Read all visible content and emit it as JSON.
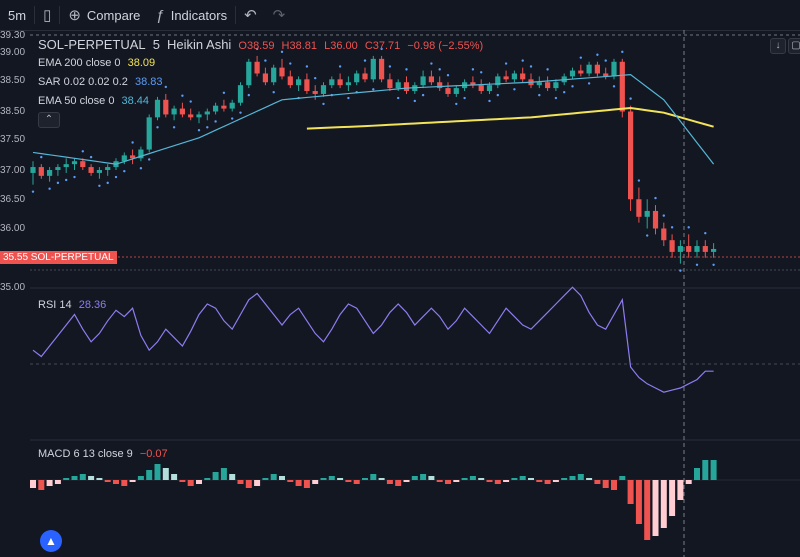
{
  "toolbar": {
    "interval": "5m",
    "compare_label": "Compare",
    "indicators_label": "Indicators"
  },
  "legend": {
    "symbol": "SOL-PERPETUAL",
    "timeframe": "5",
    "chart_style": "Heikin Ashi",
    "o": "O38.59",
    "h": "H38.81",
    "l": "L36.00",
    "c": "C37.71",
    "change": "−0.98 (−2.55%)",
    "ema200_label": "EMA 200 close 0",
    "ema200_value": "38.09",
    "sar_label": "SAR 0.02 0.02 0.2",
    "sar_value": "38.83",
    "ema50_label": "EMA 50 close 0",
    "ema50_value": "38.44"
  },
  "price_tag": "35.55 SOL-PERPETUAL",
  "rsi": {
    "label": "RSI 14",
    "value": "28.36"
  },
  "macd": {
    "label": "MACD 6 13 close 9",
    "value": "−0.07"
  },
  "colors": {
    "up": "#26a69a",
    "down": "#ef5350",
    "ema200": "#f2e35a",
    "ema50": "#55b6d6",
    "sar": "#5b9cf6",
    "rsi": "#8e7cf0",
    "background": "#131722"
  },
  "chart_data": [
    {
      "type": "candlestick",
      "title": "SOL-PERPETUAL 5 Heikin Ashi",
      "y_ticks": [
        "39.30",
        "39.00",
        "38.50",
        "38.00",
        "37.50",
        "37.00",
        "36.50",
        "36.00",
        "35.55",
        "35.00"
      ],
      "ylim": [
        35.0,
        39.3
      ],
      "candles": [
        [
          36.95,
          37.15,
          36.75,
          37.05
        ],
        [
          37.05,
          37.1,
          36.85,
          36.9
        ],
        [
          36.9,
          37.05,
          36.8,
          37.0
        ],
        [
          37.0,
          37.1,
          36.9,
          37.05
        ],
        [
          37.05,
          37.2,
          36.95,
          37.1
        ],
        [
          37.1,
          37.2,
          37.0,
          37.15
        ],
        [
          37.15,
          37.2,
          37.0,
          37.05
        ],
        [
          37.05,
          37.1,
          36.9,
          36.95
        ],
        [
          36.95,
          37.05,
          36.85,
          37.0
        ],
        [
          37.0,
          37.1,
          36.9,
          37.05
        ],
        [
          37.05,
          37.2,
          37.0,
          37.15
        ],
        [
          37.15,
          37.3,
          37.1,
          37.25
        ],
        [
          37.25,
          37.35,
          37.1,
          37.2
        ],
        [
          37.2,
          37.4,
          37.15,
          37.35
        ],
        [
          37.35,
          37.95,
          37.3,
          37.9
        ],
        [
          37.9,
          38.25,
          37.85,
          38.2
        ],
        [
          38.2,
          38.3,
          37.9,
          37.95
        ],
        [
          37.95,
          38.1,
          37.85,
          38.05
        ],
        [
          38.05,
          38.15,
          37.9,
          37.95
        ],
        [
          37.95,
          38.05,
          37.85,
          37.9
        ],
        [
          37.9,
          38.0,
          37.8,
          37.95
        ],
        [
          37.95,
          38.05,
          37.85,
          38.0
        ],
        [
          38.0,
          38.15,
          37.95,
          38.1
        ],
        [
          38.1,
          38.2,
          38.0,
          38.05
        ],
        [
          38.05,
          38.2,
          38.0,
          38.15
        ],
        [
          38.15,
          38.5,
          38.1,
          38.45
        ],
        [
          38.45,
          38.9,
          38.4,
          38.85
        ],
        [
          38.85,
          38.95,
          38.6,
          38.65
        ],
        [
          38.65,
          38.75,
          38.45,
          38.5
        ],
        [
          38.5,
          38.8,
          38.45,
          38.75
        ],
        [
          38.75,
          38.9,
          38.55,
          38.6
        ],
        [
          38.6,
          38.7,
          38.4,
          38.45
        ],
        [
          38.45,
          38.6,
          38.35,
          38.55
        ],
        [
          38.55,
          38.65,
          38.3,
          38.35
        ],
        [
          38.35,
          38.45,
          38.2,
          38.3
        ],
        [
          38.3,
          38.5,
          38.25,
          38.45
        ],
        [
          38.45,
          38.6,
          38.4,
          38.55
        ],
        [
          38.55,
          38.65,
          38.4,
          38.45
        ],
        [
          38.45,
          38.6,
          38.35,
          38.5
        ],
        [
          38.5,
          38.7,
          38.45,
          38.65
        ],
        [
          38.65,
          38.75,
          38.5,
          38.55
        ],
        [
          38.55,
          38.95,
          38.5,
          38.9
        ],
        [
          38.9,
          38.95,
          38.5,
          38.55
        ],
        [
          38.55,
          38.65,
          38.35,
          38.4
        ],
        [
          38.4,
          38.55,
          38.35,
          38.5
        ],
        [
          38.5,
          38.6,
          38.3,
          38.35
        ],
        [
          38.35,
          38.5,
          38.3,
          38.45
        ],
        [
          38.45,
          38.7,
          38.4,
          38.6
        ],
        [
          38.6,
          38.7,
          38.45,
          38.5
        ],
        [
          38.5,
          38.6,
          38.35,
          38.4
        ],
        [
          38.4,
          38.5,
          38.25,
          38.3
        ],
        [
          38.3,
          38.45,
          38.25,
          38.4
        ],
        [
          38.4,
          38.55,
          38.35,
          38.5
        ],
        [
          38.5,
          38.6,
          38.4,
          38.45
        ],
        [
          38.45,
          38.55,
          38.3,
          38.35
        ],
        [
          38.35,
          38.5,
          38.3,
          38.45
        ],
        [
          38.45,
          38.65,
          38.4,
          38.6
        ],
        [
          38.6,
          38.7,
          38.5,
          38.55
        ],
        [
          38.55,
          38.7,
          38.5,
          38.65
        ],
        [
          38.65,
          38.75,
          38.5,
          38.55
        ],
        [
          38.55,
          38.65,
          38.4,
          38.45
        ],
        [
          38.45,
          38.6,
          38.4,
          38.5
        ],
        [
          38.5,
          38.6,
          38.35,
          38.4
        ],
        [
          38.4,
          38.55,
          38.35,
          38.5
        ],
        [
          38.5,
          38.65,
          38.45,
          38.6
        ],
        [
          38.6,
          38.75,
          38.55,
          38.7
        ],
        [
          38.7,
          38.8,
          38.6,
          38.65
        ],
        [
          38.65,
          38.85,
          38.6,
          38.8
        ],
        [
          38.8,
          38.85,
          38.6,
          38.65
        ],
        [
          38.65,
          38.75,
          38.55,
          38.6
        ],
        [
          38.6,
          38.9,
          38.55,
          38.85
        ],
        [
          38.85,
          38.9,
          37.9,
          38.0
        ],
        [
          38.0,
          38.1,
          36.3,
          36.5
        ],
        [
          36.5,
          36.7,
          36.1,
          36.2
        ],
        [
          36.2,
          36.5,
          36.0,
          36.3
        ],
        [
          36.3,
          36.4,
          35.9,
          36.0
        ],
        [
          36.0,
          36.1,
          35.7,
          35.8
        ],
        [
          35.8,
          35.9,
          35.5,
          35.6
        ],
        [
          35.6,
          35.8,
          35.4,
          35.7
        ],
        [
          35.7,
          35.9,
          35.5,
          35.6
        ],
        [
          35.6,
          35.8,
          35.5,
          35.7
        ],
        [
          35.7,
          35.8,
          35.5,
          35.6
        ],
        [
          35.6,
          35.75,
          35.5,
          35.65
        ]
      ],
      "ema200": [
        [
          0,
          37.58
        ],
        [
          20,
          37.63
        ],
        [
          40,
          37.75
        ],
        [
          60,
          37.9
        ],
        [
          72,
          38.06
        ],
        [
          76,
          37.98
        ],
        [
          82,
          37.74
        ]
      ],
      "ema50": [
        [
          0,
          37.3
        ],
        [
          10,
          37.1
        ],
        [
          20,
          37.55
        ],
        [
          30,
          38.2
        ],
        [
          45,
          38.4
        ],
        [
          60,
          38.5
        ],
        [
          72,
          38.63
        ],
        [
          76,
          38.2
        ],
        [
          82,
          37.1
        ]
      ]
    },
    {
      "type": "line",
      "title": "RSI 14",
      "value": 28.36,
      "ylim": [
        0,
        100
      ],
      "values": [
        38,
        35,
        40,
        45,
        50,
        55,
        48,
        42,
        46,
        52,
        57,
        54,
        58,
        45,
        38,
        42,
        48,
        44,
        40,
        47,
        55,
        60,
        58,
        52,
        48,
        55,
        62,
        65,
        60,
        55,
        50,
        55,
        58,
        52,
        46,
        42,
        48,
        55,
        60,
        58,
        52,
        46,
        50,
        56,
        60,
        56,
        50,
        54,
        58,
        54,
        48,
        52,
        58,
        54,
        50,
        46,
        52,
        58,
        54,
        50,
        48,
        52,
        56,
        60,
        64,
        68,
        64,
        56,
        50,
        48,
        55,
        62,
        30,
        25,
        22,
        20,
        18,
        19,
        20,
        22,
        24,
        28,
        28
      ]
    },
    {
      "type": "bar",
      "title": "MACD 6 13 close 9",
      "value": -0.07,
      "values": [
        -0.04,
        -0.05,
        -0.03,
        -0.02,
        0.01,
        0.02,
        0.03,
        0.02,
        0.01,
        -0.01,
        -0.02,
        -0.03,
        -0.01,
        0.02,
        0.05,
        0.08,
        0.06,
        0.03,
        -0.01,
        -0.03,
        -0.02,
        0.01,
        0.04,
        0.06,
        0.03,
        -0.02,
        -0.04,
        -0.03,
        0.01,
        0.03,
        0.02,
        -0.01,
        -0.03,
        -0.04,
        -0.02,
        0.01,
        0.02,
        0.01,
        -0.01,
        -0.02,
        0.01,
        0.03,
        0.01,
        -0.02,
        -0.03,
        -0.01,
        0.02,
        0.03,
        0.02,
        -0.01,
        -0.02,
        -0.01,
        0.01,
        0.02,
        0.01,
        -0.01,
        -0.02,
        -0.01,
        0.01,
        0.02,
        0.01,
        -0.01,
        -0.02,
        -0.01,
        0.01,
        0.02,
        0.03,
        0.01,
        -0.02,
        -0.04,
        -0.05,
        0.02,
        -0.12,
        -0.22,
        -0.3,
        -0.28,
        -0.24,
        -0.18,
        -0.1,
        -0.02,
        0.06,
        0.1,
        0.1
      ]
    }
  ]
}
